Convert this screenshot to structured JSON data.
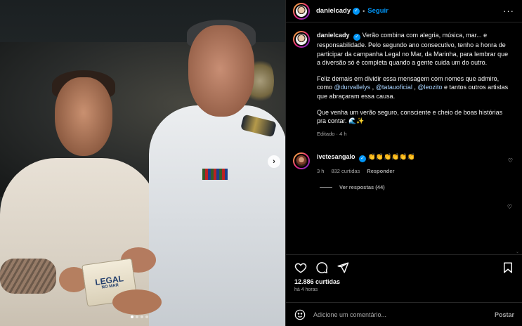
{
  "post": {
    "username": "danielcady",
    "separator": "•",
    "follow_label": "Seguir",
    "more_label": "···",
    "carousel": {
      "slide_count": 4,
      "active_slide": 1
    },
    "book_cover": {
      "title": "LEGAL",
      "subtitle": "NO MAR"
    }
  },
  "caption": {
    "username": "danielcady",
    "line1": "Verão combina com alegria, música, mar... e responsabilidade. Pelo segundo ano consecutivo, tenho a honra de participar da campanha Legal no Mar, da Marinha, para lembrar que a diversão só é completa quando a gente cuida um do outro.",
    "para2_pre": "Feliz demais em dividir essa mensagem com nomes que admiro, como ",
    "mention1": "@durvallelys",
    "comma1": " , ",
    "mention2": "@tatauoficial",
    "comma2": " , ",
    "mention3": "@leozito",
    "para2_post": " e tantos outros artistas que abraçaram essa causa.",
    "para3": "Que venha um verão seguro, consciente e cheio de boas histórias pra contar. 🌊✨",
    "meta": "Editado · 4 h"
  },
  "comment": {
    "username": "ivetesangalo",
    "text": "👏👏👏👏👏👏",
    "time": "3 h",
    "likes": "832 curtidas",
    "reply": "Responder",
    "view_replies": "Ver respostas (44)"
  },
  "stats": {
    "likes": "12.886 curtidas",
    "time": "há 4 horas"
  },
  "composer": {
    "placeholder": "Adicione um comentário...",
    "post_label": "Postar"
  },
  "colors": {
    "background": "#000000",
    "link": "#0095f6",
    "muted": "#a8a8a8"
  },
  "icons": [
    "verified-icon",
    "more-icon",
    "heart-icon",
    "comment-icon",
    "share-icon",
    "save-icon",
    "emoji-icon",
    "next-arrow-icon"
  ]
}
